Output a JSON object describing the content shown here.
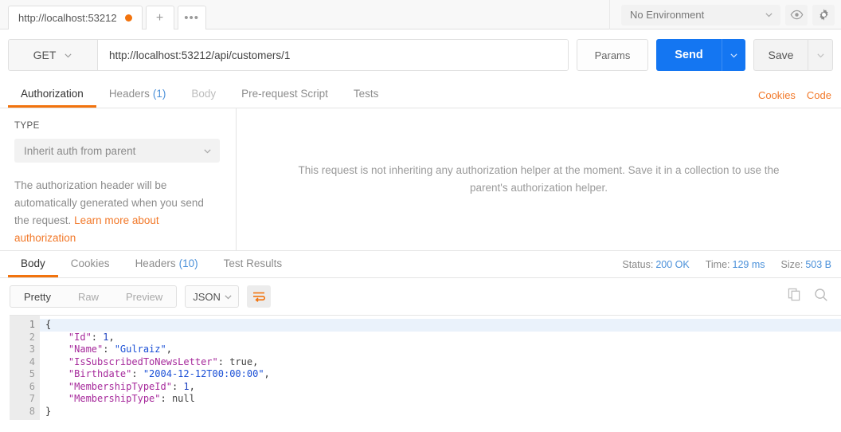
{
  "topbar": {
    "request_tab_title": "http://localhost:53212",
    "unsaved_dot": "unsaved-indicator",
    "new_tab_label": "+",
    "more_label": "•••",
    "environment": "No Environment",
    "eye_icon": "eye-icon",
    "gear_icon": "gear-icon"
  },
  "urlbar": {
    "method": "GET",
    "url": "http://localhost:53212/api/customers/1",
    "params_label": "Params",
    "send_label": "Send",
    "save_label": "Save"
  },
  "request_tabs": {
    "items": [
      {
        "label": "Authorization",
        "count": "",
        "active": true,
        "dim": false
      },
      {
        "label": "Headers",
        "count": "(1)",
        "active": false,
        "dim": false
      },
      {
        "label": "Body",
        "count": "",
        "active": false,
        "dim": true
      },
      {
        "label": "Pre-request Script",
        "count": "",
        "active": false,
        "dim": false
      },
      {
        "label": "Tests",
        "count": "",
        "active": false,
        "dim": false
      }
    ],
    "cookies_label": "Cookies",
    "code_label": "Code"
  },
  "auth": {
    "type_label": "TYPE",
    "type_value": "Inherit auth from parent",
    "note_text": "The authorization header will be automatically generated when you send the request. ",
    "note_link": "Learn more about authorization",
    "inherit_message": "This request is not inheriting any authorization helper at the moment. Save it in a collection to use the parent's authorization helper."
  },
  "response": {
    "tabs": [
      {
        "label": "Body",
        "count": "",
        "active": true
      },
      {
        "label": "Cookies",
        "count": "",
        "active": false
      },
      {
        "label": "Headers",
        "count": "(10)",
        "active": false
      },
      {
        "label": "Test Results",
        "count": "",
        "active": false
      }
    ],
    "status_label": "Status:",
    "status_value": "200 OK",
    "time_label": "Time:",
    "time_value": "129 ms",
    "size_label": "Size:",
    "size_value": "503 B",
    "view_modes": [
      {
        "label": "Pretty",
        "active": true
      },
      {
        "label": "Raw",
        "active": false
      },
      {
        "label": "Preview",
        "active": false
      }
    ],
    "format": "JSON",
    "wrap_icon": "word-wrap-icon",
    "copy_icon": "copy-icon",
    "search_icon": "search-icon",
    "body_lines": [
      {
        "no": "1",
        "tokens": [
          {
            "t": "{",
            "c": "p"
          }
        ]
      },
      {
        "no": "2",
        "tokens": [
          {
            "t": "    \"Id\"",
            "c": "k"
          },
          {
            "t": ": ",
            "c": "p"
          },
          {
            "t": "1",
            "c": "n"
          },
          {
            "t": ",",
            "c": "p"
          }
        ]
      },
      {
        "no": "3",
        "tokens": [
          {
            "t": "    \"Name\"",
            "c": "k"
          },
          {
            "t": ": ",
            "c": "p"
          },
          {
            "t": "\"Gulraiz\"",
            "c": "s"
          },
          {
            "t": ",",
            "c": "p"
          }
        ]
      },
      {
        "no": "4",
        "tokens": [
          {
            "t": "    \"IsSubscribedToNewsLetter\"",
            "c": "k"
          },
          {
            "t": ": ",
            "c": "p"
          },
          {
            "t": "true",
            "c": "lit"
          },
          {
            "t": ",",
            "c": "p"
          }
        ]
      },
      {
        "no": "5",
        "tokens": [
          {
            "t": "    \"Birthdate\"",
            "c": "k"
          },
          {
            "t": ": ",
            "c": "p"
          },
          {
            "t": "\"2004-12-12T00:00:00\"",
            "c": "s"
          },
          {
            "t": ",",
            "c": "p"
          }
        ]
      },
      {
        "no": "6",
        "tokens": [
          {
            "t": "    \"MembershipTypeId\"",
            "c": "k"
          },
          {
            "t": ": ",
            "c": "p"
          },
          {
            "t": "1",
            "c": "n"
          },
          {
            "t": ",",
            "c": "p"
          }
        ]
      },
      {
        "no": "7",
        "tokens": [
          {
            "t": "    \"MembershipType\"",
            "c": "k"
          },
          {
            "t": ": ",
            "c": "p"
          },
          {
            "t": "null",
            "c": "lit"
          }
        ]
      },
      {
        "no": "8",
        "tokens": [
          {
            "t": "}",
            "c": "p"
          }
        ]
      }
    ]
  },
  "colors": {
    "accent_orange": "#f2730d",
    "send_blue": "#1476f2",
    "status_blue": "#4a90d9",
    "key_purple": "#a6299b",
    "string_blue": "#1a4fd6"
  }
}
